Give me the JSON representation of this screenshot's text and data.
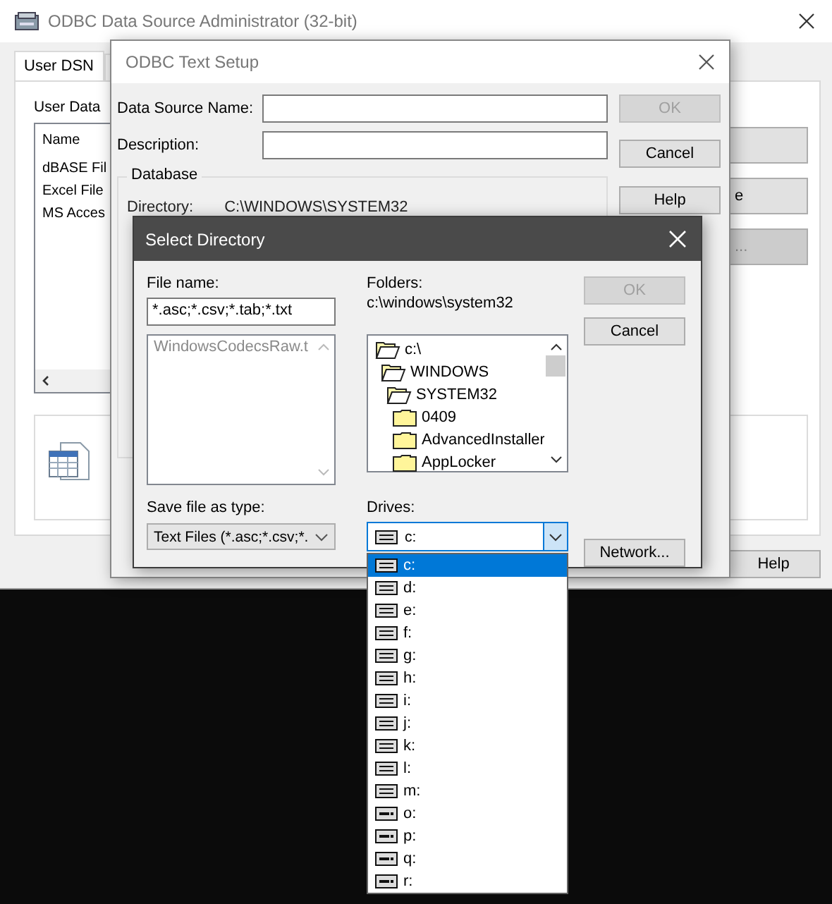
{
  "admin_window": {
    "title": "ODBC Data Source Administrator (32-bit)",
    "tabs": [
      {
        "label": "User DSN",
        "selected": true
      }
    ],
    "section_label": "User Data",
    "list": {
      "columns": [
        "Name"
      ],
      "rows": [
        "dBASE Fil",
        "Excel File",
        "MS Acces"
      ]
    },
    "side_buttons": [
      {
        "label": "e",
        "disabled": false
      },
      {
        "label": "...",
        "disabled": true
      }
    ],
    "help_button": "Help"
  },
  "text_setup": {
    "title": "ODBC Text Setup",
    "fields": [
      {
        "label": "Data Source Name:"
      },
      {
        "label": "Description:"
      }
    ],
    "buttons": [
      {
        "label": "OK",
        "disabled": true
      },
      {
        "label": "Cancel",
        "disabled": false
      },
      {
        "label": "Help",
        "disabled": false
      }
    ],
    "group_label": "Database",
    "directory_label": "Directory:",
    "directory_value": "C:\\WINDOWS\\SYSTEM32"
  },
  "select_directory": {
    "title": "Select Directory",
    "file_name_label": "File name:",
    "file_name_value": "*.asc;*.csv;*.tab;*.txt",
    "files": [
      "WindowsCodecsRaw.t"
    ],
    "folders_label": "Folders:",
    "current_path": "c:\\windows\\system32",
    "folders": [
      {
        "label": "c:\\",
        "open": true,
        "children": [
          {
            "label": "WINDOWS",
            "open": true,
            "children": [
              {
                "label": "SYSTEM32",
                "open": true,
                "children": [
                  {
                    "label": "0409",
                    "open": false
                  },
                  {
                    "label": "AdvancedInstaller",
                    "open": false
                  },
                  {
                    "label": "AppLocker",
                    "open": false
                  }
                ]
              }
            ]
          }
        ]
      }
    ],
    "buttons": [
      {
        "label": "OK",
        "disabled": true
      },
      {
        "label": "Cancel",
        "disabled": false
      }
    ],
    "type_label": "Save file as type:",
    "type_value": "Text Files (*.asc;*.csv;*.",
    "drives_label": "Drives:",
    "drive_value": "c:",
    "network_button": "Network...",
    "drives": [
      {
        "label": "c:",
        "kind": "fixed",
        "selected": true
      },
      {
        "label": "d:",
        "kind": "fixed",
        "selected": false
      },
      {
        "label": "e:",
        "kind": "fixed",
        "selected": false
      },
      {
        "label": "f:",
        "kind": "fixed",
        "selected": false
      },
      {
        "label": "g:",
        "kind": "fixed",
        "selected": false
      },
      {
        "label": "h:",
        "kind": "fixed",
        "selected": false
      },
      {
        "label": "i:",
        "kind": "fixed",
        "selected": false
      },
      {
        "label": "j:",
        "kind": "fixed",
        "selected": false
      },
      {
        "label": "k:",
        "kind": "fixed",
        "selected": false
      },
      {
        "label": "l:",
        "kind": "fixed",
        "selected": false
      },
      {
        "label": "m:",
        "kind": "fixed",
        "selected": false
      },
      {
        "label": "o:",
        "kind": "network",
        "selected": false
      },
      {
        "label": "p:",
        "kind": "network",
        "selected": false
      },
      {
        "label": "q:",
        "kind": "network",
        "selected": false
      },
      {
        "label": "r:",
        "kind": "network",
        "selected": false
      }
    ]
  }
}
